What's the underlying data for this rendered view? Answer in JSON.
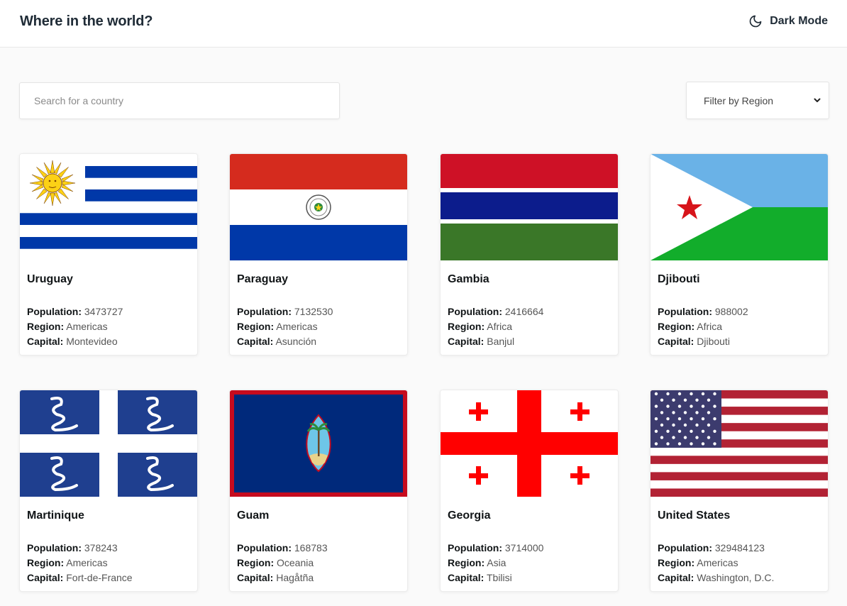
{
  "header": {
    "title": "Where in the world?",
    "dark_mode_label": "Dark Mode",
    "dark_mode_icon": "moon-icon"
  },
  "search": {
    "placeholder": "Search for a country",
    "value": ""
  },
  "filter": {
    "selected": "Filter by Region",
    "icon": "chevron-down-icon"
  },
  "labels": {
    "population": "Population:",
    "region": "Region:",
    "capital": "Capital:"
  },
  "countries": [
    {
      "name": "Uruguay",
      "population": "3473727",
      "region": "Americas",
      "capital": "Montevideo",
      "flag": "uruguay-flag"
    },
    {
      "name": "Paraguay",
      "population": "7132530",
      "region": "Americas",
      "capital": "Asunción",
      "flag": "paraguay-flag"
    },
    {
      "name": "Gambia",
      "population": "2416664",
      "region": "Africa",
      "capital": "Banjul",
      "flag": "gambia-flag"
    },
    {
      "name": "Djibouti",
      "population": "988002",
      "region": "Africa",
      "capital": "Djibouti",
      "flag": "djibouti-flag"
    },
    {
      "name": "Martinique",
      "population": "378243",
      "region": "Americas",
      "capital": "Fort-de-France",
      "flag": "martinique-flag"
    },
    {
      "name": "Guam",
      "population": "168783",
      "region": "Oceania",
      "capital": "Hagåtña",
      "flag": "guam-flag"
    },
    {
      "name": "Georgia",
      "population": "3714000",
      "region": "Asia",
      "capital": "Tbilisi",
      "flag": "georgia-flag"
    },
    {
      "name": "United States",
      "population": "329484123",
      "region": "Americas",
      "capital": "Washington, D.C.",
      "flag": "united-states-flag"
    }
  ],
  "colors": {
    "uruguay_blue": "#0038a8",
    "uruguay_sun": "#fcd116",
    "paraguay_red": "#d52b1e",
    "paraguay_blue": "#0038a8",
    "gambia_red": "#ce1126",
    "gambia_blue": "#0c1c8c",
    "gambia_green": "#3a7728",
    "djibouti_blue": "#6ab2e7",
    "djibouti_green": "#12ad2b",
    "djibouti_star": "#d7141a",
    "martinique_blue": "#1f3f8f",
    "guam_blue": "#00297b",
    "guam_red": "#c60b1e",
    "georgia_red": "#ff0000",
    "us_red": "#b22234",
    "us_blue": "#3c3b6e"
  }
}
